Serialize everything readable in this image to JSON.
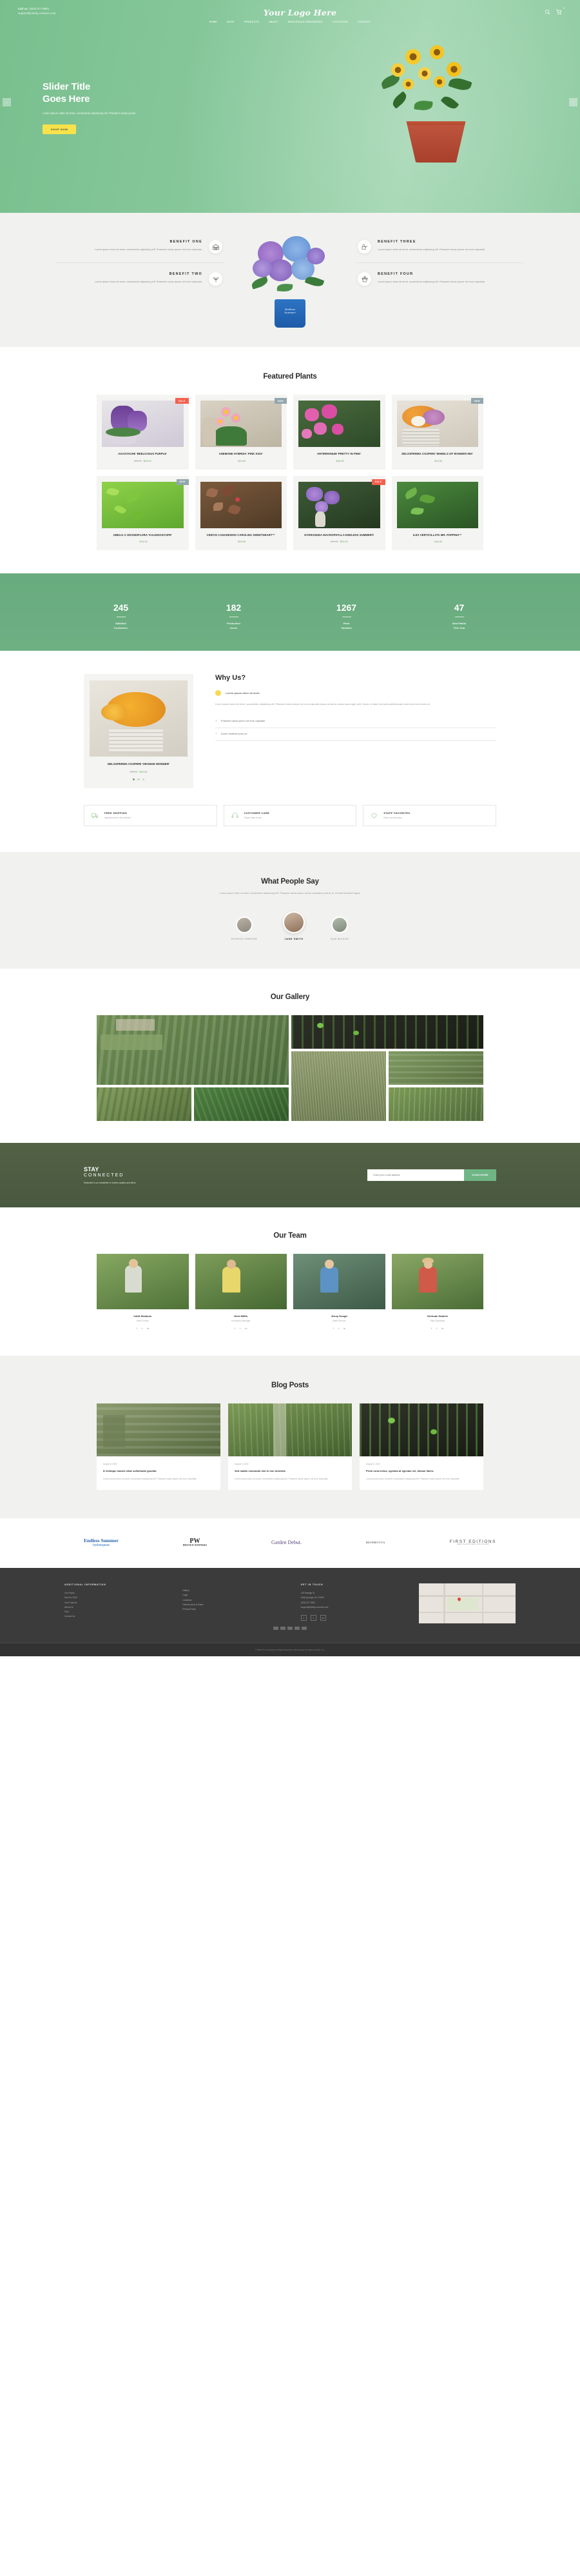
{
  "header": {
    "call_label": "Call us:",
    "phone": "(919) 577-9901",
    "email": "support@clarity-connect.com",
    "logo": "Your Logo Here",
    "cart_count": "0",
    "search_icon": "search-icon",
    "cart_icon": "cart-icon",
    "nav": [
      {
        "label": "HOME"
      },
      {
        "label": "SHOP"
      },
      {
        "label": "PRODUCTS"
      },
      {
        "label": "ABOUT"
      },
      {
        "label": "WHOLESALE RESOURCES"
      },
      {
        "label": "LOCATIONS"
      },
      {
        "label": "CONTACT"
      }
    ]
  },
  "hero": {
    "title_line1": "Slider Title",
    "title_line2": "Goes Here",
    "body": "Lorem ipsum dolor sit amet, consectetur adipiscing elit. Praesent varius ipsum.",
    "cta": "SHOP NOW",
    "prev_arrow": "chevron-left-icon",
    "next_arrow": "chevron-right-icon"
  },
  "benefits": {
    "items": [
      {
        "title": "BENEFIT ONE",
        "body": "Lorem ipsum dolor sit amet, consectetur adipiscing elit. Praesent varius ipsum vel eros vulputate.",
        "icon": "barn-icon"
      },
      {
        "title": "BENEFIT THREE",
        "body": "Lorem ipsum dolor sit amet, consectetur adipiscing elit. Praesent varius ipsum vel eros vulputate.",
        "icon": "watering-can-icon"
      },
      {
        "title": "BENEFIT TWO",
        "body": "Lorem ipsum dolor sit amet, consectetur adipiscing elit. Praesent varius ipsum vel eros vulputate.",
        "icon": "seedling-icon"
      },
      {
        "title": "BENEFIT FOUR",
        "body": "Lorem ipsum dolor sit amet, consectetur adipiscing elit. Praesent varius ipsum vel eros vulputate.",
        "icon": "flower-pot-icon"
      }
    ],
    "vase_text": "Endless\nSummer"
  },
  "featured": {
    "title": "Featured Plants",
    "products": [
      {
        "name": "AGASTACHE 'BEELICIOUS PURPLE'",
        "old_price": "$30.00",
        "price": "$23.00",
        "badge": "SALE",
        "badge_kind": "sale"
      },
      {
        "name": "ANEMONE HYBRIDA 'PINK KISS'",
        "old_price": "",
        "price": "$13.00",
        "badge": "NEW",
        "badge_kind": "new"
      },
      {
        "name": "ANTIRRHINUM 'PRETTY IN PINK'",
        "old_price": "",
        "price": "$16.99",
        "badge": "",
        "badge_kind": ""
      },
      {
        "name": "DELOSPERMA COOPERI 'WHEELS OF WONDER MIX'",
        "old_price": "",
        "price": "$13.00",
        "badge": "NEW",
        "badge_kind": "new"
      },
      {
        "name": "ABELIA X GRANDIFLORA 'KALEIDOSCOPE'",
        "old_price": "",
        "price": "$13.00",
        "badge": "NEW",
        "badge_kind": "new"
      },
      {
        "name": "CERCIS CANADENSIS CAROLINA SWEETHEART™",
        "old_price": "",
        "price": "$16.99",
        "badge": "",
        "badge_kind": ""
      },
      {
        "name": "HYDRANGEA MACROPHYLLA ENDLESS SUMMER®",
        "old_price": "$30.00",
        "price": "$23.00",
        "badge": "SALE",
        "badge_kind": "sale"
      },
      {
        "name": "ILEX VERTICILLATA MR. POPPINS™",
        "old_price": "",
        "price": "$16.99",
        "badge": "",
        "badge_kind": ""
      }
    ]
  },
  "counters": [
    {
      "value": "245",
      "label_1": "Satisfied",
      "label_2": "Customers"
    },
    {
      "value": "182",
      "label_1": "Production",
      "label_2": "Acres"
    },
    {
      "value": "1267",
      "label_1": "Plant",
      "label_2": "Varieties"
    },
    {
      "value": "47",
      "label_1": "New Plants",
      "label_2": "This Year"
    }
  ],
  "whyus": {
    "title": "Why Us?",
    "product": {
      "name": "DELOSPERMA COOPERI 'ORANGE WONDER'",
      "old_price": "$30.00",
      "price": "$23.00"
    },
    "lead": "Lorem ipsum dolor sit amet.",
    "body": "Lorem ipsum dolor sit amet, consectetur adipiscing elit. Praesent varius ipsum vel eros vulputate ipsum at lorem cursus lacus eget velit. Donec ut diam sed justo pellentesque viverra at lorem dolor at.",
    "accordion": [
      {
        "label": "Praesent varius ipsum vel eros vulputate"
      },
      {
        "label": "Donec eleifend tortor eu"
      }
    ],
    "features": [
      {
        "title": "FREE SHIPPING",
        "body": "Important text in this element",
        "icon": "shipping-truck-icon"
      },
      {
        "title": "CUSTOMER CARE",
        "body": "Proper rates in real",
        "icon": "headset-icon"
      },
      {
        "title": "STAFF FAVORITES",
        "body": "Read our best picks",
        "icon": "heart-icon"
      }
    ]
  },
  "testimonials": {
    "title": "What People Say",
    "subtitle": "Lorem ipsum dolor sit amet, consectetur adipiscing elit. Praesent varius ipsum varius vulputate porta ac in, sit amet tincidunt ligula.",
    "people": [
      {
        "name": "PATRICK SIMPSON"
      },
      {
        "name": "JANE SMITH"
      },
      {
        "name": "SAM WILSON"
      }
    ]
  },
  "gallery": {
    "title": "Our Gallery",
    "items": [
      {
        "alt": "nursery-aerial-view"
      },
      {
        "alt": "seedling-tray-sprouts"
      },
      {
        "alt": "ornamental-grass-field"
      },
      {
        "alt": "greenhouse-interior"
      },
      {
        "alt": "nursery-container-rows"
      },
      {
        "alt": "shrub-field-green"
      },
      {
        "alt": "tree-rows-pathway"
      }
    ]
  },
  "newsletter": {
    "title_1": "STAY",
    "title_2": "CONNECTED",
    "sub": "Subscribe to our newsletter to receive updates and offers",
    "placeholder": "Enter your e-mail address",
    "button": "SUBSCRIBE"
  },
  "team": {
    "title": "Our Team",
    "members": [
      {
        "name": "Callie Brabson",
        "role": "Head Grower",
        "socials": [
          "f",
          "t",
          "in"
        ]
      },
      {
        "name": "Herb Miffin",
        "role": "Production Manager",
        "socials": [
          "f",
          "t",
          "in"
        ]
      },
      {
        "name": "Jenny Dough",
        "role": "Sales Director",
        "socials": [
          "f",
          "t",
          "in"
        ]
      },
      {
        "name": "Gertrude Daniels",
        "role": "Plant Specialist",
        "socials": [
          "f",
          "t",
          "in"
        ]
      }
    ]
  },
  "blog": {
    "title": "Blog Posts",
    "posts": [
      {
        "date": "August 5, 2020",
        "title": "In tristique mauris vitae sollicitudin gravida",
        "body": "Lorem ipsum dolor sit amet, consectetur adipiscing elit. Praesent varius ipsum vel eros vulputate."
      },
      {
        "date": "August 5, 2020",
        "title": "Sed mattis commodo nisl in non molestie.",
        "body": "Lorem ipsum dolor sit amet, consectetur adipiscing elit. Praesent varius ipsum vel eros vulputate."
      },
      {
        "date": "August 5, 2020",
        "title": "Proin urna lectus, egestas at egestas vel, dictum libero.",
        "body": "Lorem ipsum dolor sit amet, consectetur adipiscing elit. Praesent varius ipsum vel eros vulputate."
      }
    ]
  },
  "brands": [
    {
      "name": "Endless Summer",
      "sub": "hydrangeas",
      "kind": "b1"
    },
    {
      "name": "PW",
      "sub": "PROVEN WINNERS",
      "kind": "b2"
    },
    {
      "name": "Garden Debut.",
      "sub": "",
      "kind": "b3"
    },
    {
      "name": "MONROVIA",
      "sub": "",
      "kind": "b4"
    },
    {
      "name": "FIRST EDITIONS",
      "sub": "NEW PLANTS NEW SOLUTIONS",
      "kind": "b5"
    }
  ],
  "footer": {
    "col1": {
      "heading": "ADDITIONAL INFORMATION",
      "links": [
        "Our Plants",
        "New for 2020",
        "Our Products",
        "About Us",
        "FAQ",
        "Contact Us"
      ]
    },
    "col2": {
      "heading": "",
      "links": [
        "Gallery",
        "Login",
        "Locations",
        "Delivery Area & Rates",
        "Privacy Policy"
      ]
    },
    "col3": {
      "heading": "GET IN TOUCH",
      "address_1": "176 Raleigh St.",
      "address_2": "Holly Springs, NC 27540",
      "phone": "(919) 577-9901",
      "email": "support@clarity-connect.com",
      "socials": [
        "f",
        "t",
        "in"
      ]
    },
    "map_alt": "location-map",
    "copyright": "© 2020 Your Company. All Rights Reserved. Web Design by Clarity Connect, Inc."
  }
}
